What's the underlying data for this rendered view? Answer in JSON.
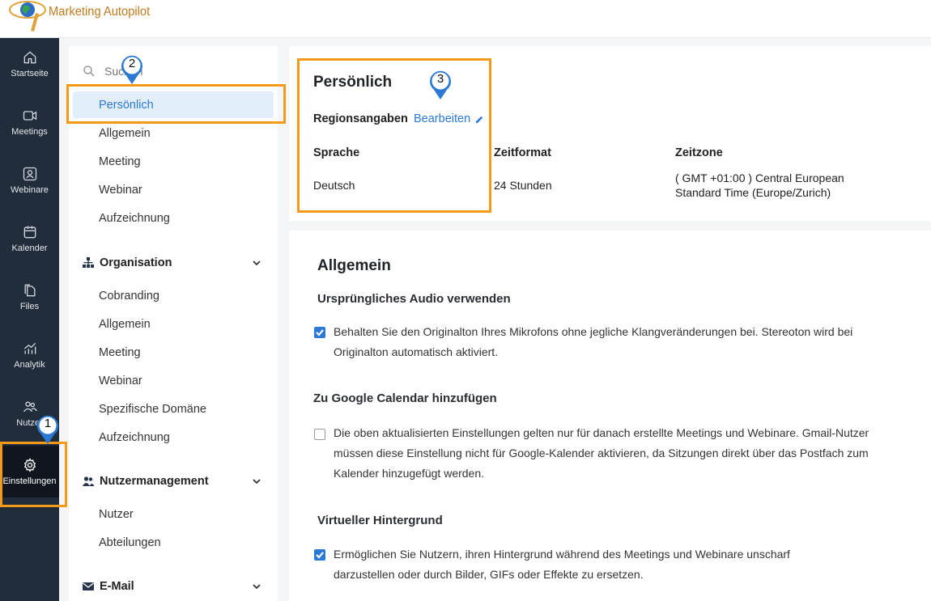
{
  "app": {
    "logo_text": "Marketing Autopilot"
  },
  "leftnav": {
    "items": [
      {
        "label": "Startseite",
        "icon": "home-icon"
      },
      {
        "label": "Meetings",
        "icon": "video-icon"
      },
      {
        "label": "Webinare",
        "icon": "webinar-icon"
      },
      {
        "label": "Kalender",
        "icon": "calendar-icon"
      },
      {
        "label": "Files",
        "icon": "files-icon"
      },
      {
        "label": "Analytik",
        "icon": "analytics-icon"
      },
      {
        "label": "Nutzer",
        "icon": "users-icon"
      },
      {
        "label": "Einstellungen",
        "icon": "gear-icon"
      }
    ]
  },
  "sidebar": {
    "search_placeholder": "Suchen",
    "personal_items": [
      "Persönlich",
      "Allgemein",
      "Meeting",
      "Webinar",
      "Aufzeichnung"
    ],
    "groups": [
      {
        "title": "Organisation",
        "icon": "org-chart-icon",
        "items": [
          "Cobranding",
          "Allgemein",
          "Meeting",
          "Webinar",
          "Spezifische Domäne",
          "Aufzeichnung"
        ]
      },
      {
        "title": "Nutzermanagement",
        "icon": "users-group-icon",
        "items": [
          "Nutzer",
          "Abteilungen"
        ]
      },
      {
        "title": "E-Mail",
        "icon": "mail-icon",
        "items": []
      }
    ]
  },
  "personal": {
    "title": "Persönlich",
    "region_label": "Regionsangaben",
    "edit_label": "Bearbeiten",
    "columns": [
      {
        "label": "Sprache",
        "value": "Deutsch"
      },
      {
        "label": "Zeitformat",
        "value": "24 Stunden"
      },
      {
        "label": "Zeitzone",
        "value": "( GMT +01:00 ) Central European Standard Time (Europe/Zurich)"
      }
    ]
  },
  "general": {
    "title": "Allgemein",
    "options": [
      {
        "title": "Ursprüngliches Audio verwenden",
        "checked": true,
        "text": "Behalten Sie den Originalton Ihres Mikrofons ohne jegliche Klangveränderungen bei. Stereoton wird bei Originalton automatisch aktiviert."
      },
      {
        "title": "Zu Google Calendar hinzufügen",
        "checked": false,
        "text": "Die oben aktualisierten Einstellungen gelten nur für danach erstellte Meetings und Webinare. Gmail-Nutzer müssen diese Einstellung nicht für Google-Kalender aktivieren, da Sitzungen direkt über das Postfach zum Kalender hinzugefügt werden."
      },
      {
        "title": "Virtueller Hintergrund",
        "checked": true,
        "text": "Ermöglichen Sie Nutzern, ihren Hintergrund während des Meetings und Webinare unscharf darzustellen oder durch Bilder, GIFs oder Effekte zu ersetzen."
      }
    ]
  },
  "annotations": {
    "markers": [
      "1",
      "2",
      "3"
    ],
    "highlight_color": "#f39b17",
    "marker_color": "#2b79d4"
  }
}
